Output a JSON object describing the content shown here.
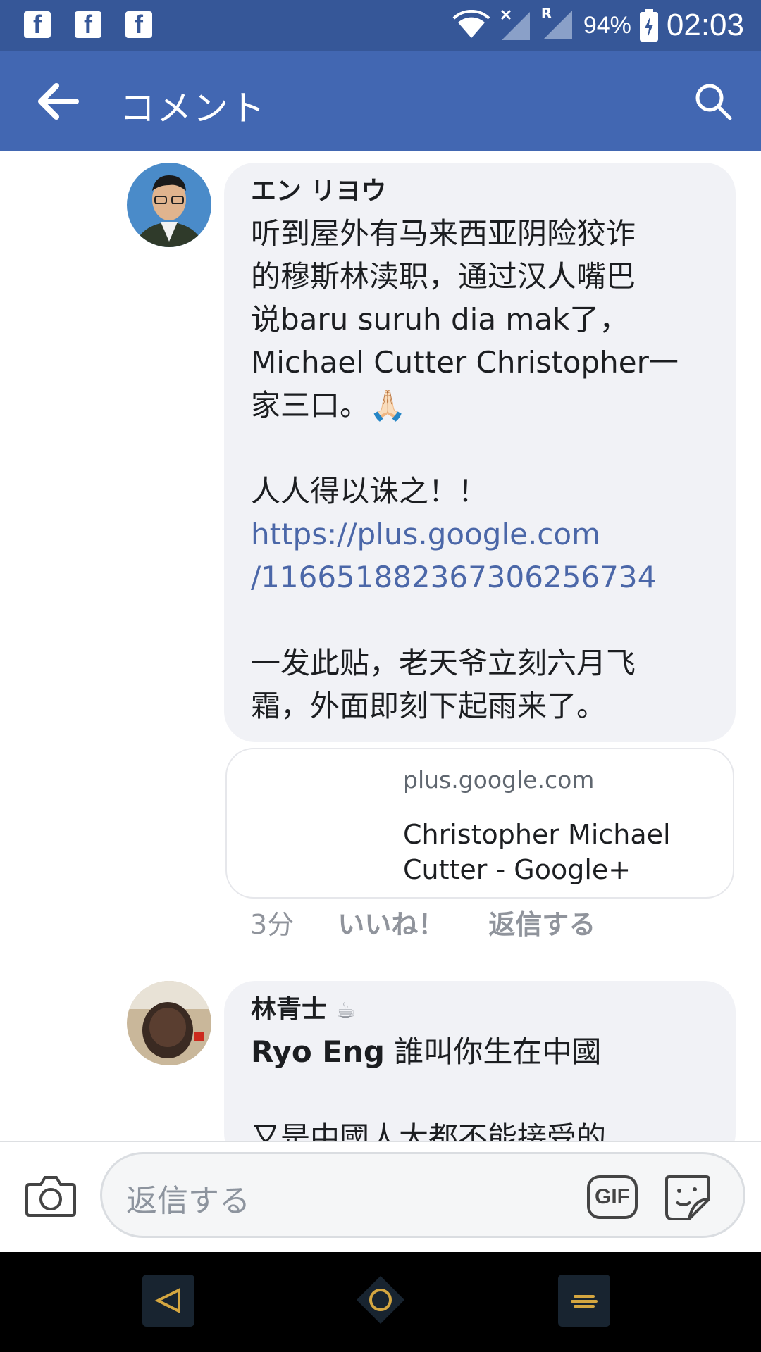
{
  "status_bar": {
    "battery": "94%",
    "time": "02:03",
    "roaming": "R",
    "notification_icons": [
      "facebook-icon",
      "facebook-icon",
      "facebook-icon"
    ]
  },
  "app_bar": {
    "title": "コメント"
  },
  "comments": [
    {
      "author": "エン リヨウ",
      "lines_before_link": [
        "听到屋外有马来西亚阴险狡诈",
        "的穆斯林渎职，通过汉人嘴巴",
        "说baru suruh dia mak了，",
        "Michael Cutter Christopher一",
        "家三口。🙏🏻",
        "",
        "人人得以诛之！！"
      ],
      "link_lines": [
        "https://plus.google.com",
        "/116651882367306256734"
      ],
      "lines_after_link": [
        "",
        "一发此贴，老天爷立刻六月飞",
        "霜，外面即刻下起雨来了。"
      ],
      "link_preview": {
        "domain": "plus.google.com",
        "title": "Christopher Michael Cutter - Google+"
      },
      "time": "3分",
      "like_label": "いいね！",
      "reply_label": "返信する"
    },
    {
      "author": "林青士",
      "author_badge": "☕",
      "mention": "Ryo Eng",
      "text": " 誰叫你生在中國",
      "partial_line": "又是中國人大都不能接受的，"
    }
  ],
  "reply_bar": {
    "placeholder": "返信する",
    "gif_label": "GIF"
  },
  "colors": {
    "status_bar": "#365798",
    "app_bar": "#4267b2",
    "link": "#4b67a8",
    "bubble": "#f1f2f6"
  }
}
